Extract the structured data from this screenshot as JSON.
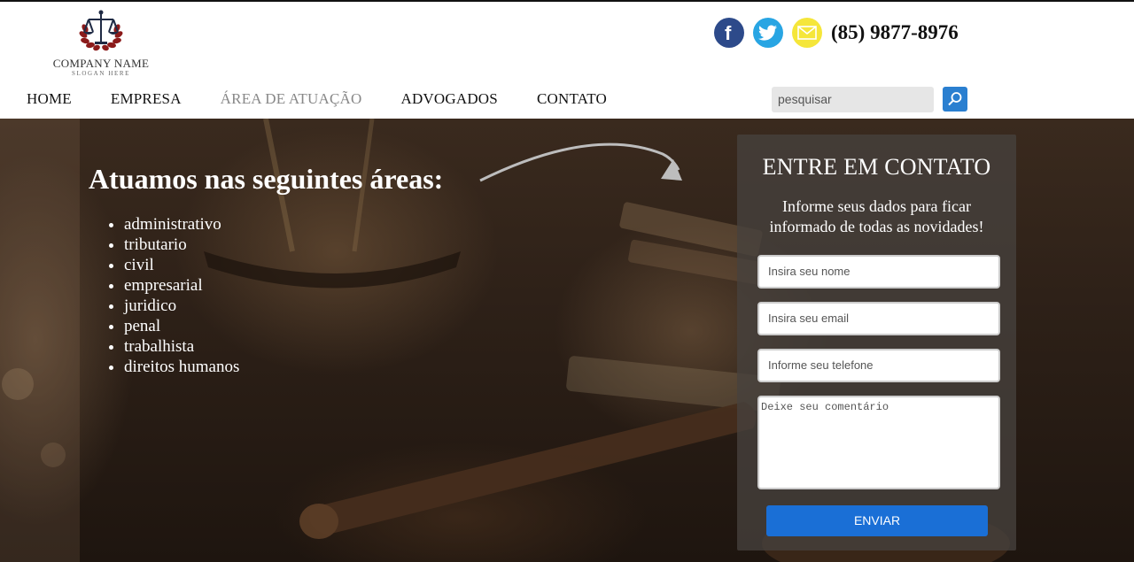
{
  "brand": {
    "company_name": "COMPANY NAME",
    "slogan": "SLOGAN HERE",
    "logo_icon": "scales-of-justice-laurel-icon"
  },
  "header": {
    "social": [
      {
        "name": "facebook",
        "icon": "facebook-icon",
        "color": "#2d4a8a"
      },
      {
        "name": "twitter",
        "icon": "twitter-icon",
        "color": "#28a5e3"
      },
      {
        "name": "email",
        "icon": "mail-icon",
        "color": "#f5e63a"
      }
    ],
    "phone": "(85) 9877-8976"
  },
  "nav": {
    "items": [
      {
        "label": "HOME",
        "active": false
      },
      {
        "label": "EMPRESA",
        "active": false
      },
      {
        "label": "ÁREA DE ATUAÇÃO",
        "active": true
      },
      {
        "label": "ADVOGADOS",
        "active": false
      },
      {
        "label": "CONTATO",
        "active": false
      }
    ]
  },
  "search": {
    "placeholder": "pesquisar",
    "button_icon": "search-icon",
    "button_color": "#2a7fd0"
  },
  "hero": {
    "title": "Atuamos nas seguintes áreas:",
    "areas": [
      "administrativo",
      "tributario",
      "civil",
      "empresarial",
      "juridico",
      "penal",
      "trabalhista",
      "direitos humanos"
    ]
  },
  "contact_form": {
    "title": "ENTRE EM CONTATO",
    "subtitle": "Informe seus dados para ficar informado de todas as novidades!",
    "name_placeholder": "Insira seu nome",
    "email_placeholder": "Insira seu email",
    "phone_placeholder": "Informe seu telefone",
    "comment_placeholder": "Deixe seu comentário",
    "submit_label": "ENVIAR",
    "submit_color": "#1a6fd6"
  }
}
